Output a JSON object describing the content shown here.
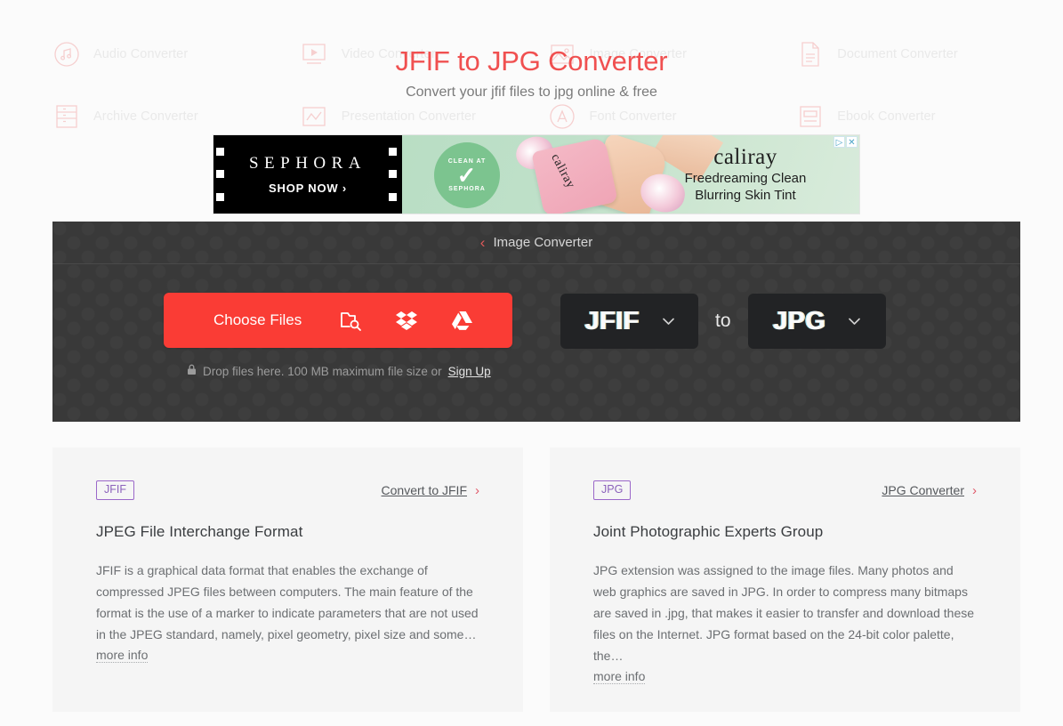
{
  "background_nav": {
    "items": [
      {
        "label": "Audio Converter",
        "icon": "music-note-icon"
      },
      {
        "label": "Video Converter",
        "icon": "video-play-icon"
      },
      {
        "label": "Image Converter",
        "icon": "image-icon"
      },
      {
        "label": "Document Converter",
        "icon": "document-icon"
      },
      {
        "label": "Archive Converter",
        "icon": "archive-icon"
      },
      {
        "label": "Presentation Converter",
        "icon": "presentation-chart-icon"
      },
      {
        "label": "Font Converter",
        "icon": "font-letter-a-icon"
      },
      {
        "label": "Ebook Converter",
        "icon": "ebook-icon"
      }
    ]
  },
  "hero": {
    "title": "JFIF to JPG Converter",
    "subtitle": "Convert your jfif files to jpg online & free",
    "title_color": "#f05050"
  },
  "ad": {
    "brand": "SEPHORA",
    "cta": "SHOP NOW ›",
    "seal_top": "CLEAN AT",
    "seal_bottom": "SEPHORA",
    "product_label": "caliray",
    "headline": "caliray",
    "line1": "Freedreaming Clean",
    "line2": "Blurring Skin Tint",
    "adchoices_icon": "adchoices-icon",
    "close_icon": "close-icon",
    "close_label": "✕",
    "adchoices_label": "▷"
  },
  "widget": {
    "breadcrumb": {
      "chevron": "‹",
      "label": "Image Converter"
    },
    "choose_files": {
      "label": "Choose Files",
      "icons": [
        {
          "name": "folder-search-icon"
        },
        {
          "name": "dropbox-icon"
        },
        {
          "name": "google-drive-icon"
        }
      ],
      "accent_color": "#fa3c35"
    },
    "drop_note": {
      "lock_icon": "lock-icon",
      "text": "Drop files here. 100 MB maximum file size or",
      "signup_label": "Sign Up"
    },
    "format_from": {
      "value": "JFIF",
      "chevron": "⌄"
    },
    "separator": "to",
    "format_to": {
      "value": "JPG",
      "chevron": "⌄"
    }
  },
  "cards": [
    {
      "badge": "JFIF",
      "link_label": "Convert to JFIF",
      "link_chevron": "›",
      "title": "JPEG File Interchange Format",
      "description": "JFIF is a graphical data format that enables the exchange of compressed JPEG files between computers. The main feature of the format is the use of a marker to indicate parameters that are not used in the JPEG standard, namely, pixel geometry, pixel size and some…",
      "more_info": "more info"
    },
    {
      "badge": "JPG",
      "link_label": "JPG Converter",
      "link_chevron": "›",
      "title": "Joint Photographic Experts Group",
      "description": "JPG extension was assigned to the image files. Many photos and web graphics are saved in JPG. In order to compress many bitmaps are saved in .jpg, that makes it easier to transfer and download these files on the Internet. JPG format based on the 24-bit color palette, the…",
      "more_info": "more info"
    }
  ]
}
